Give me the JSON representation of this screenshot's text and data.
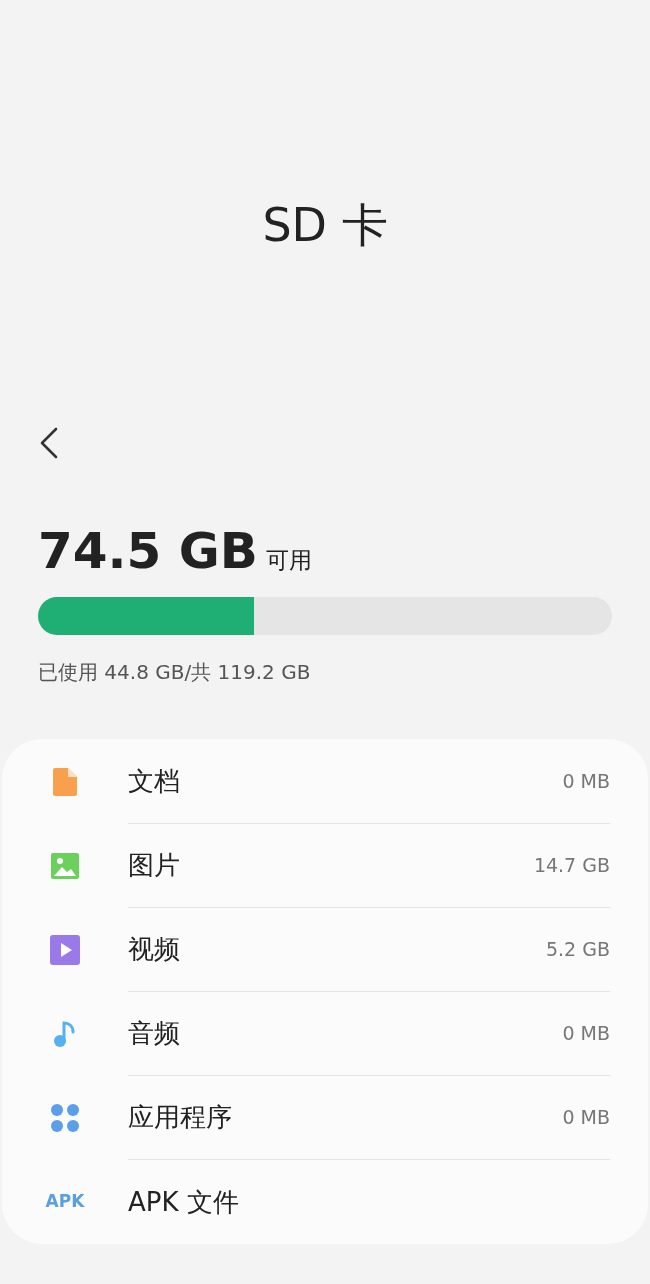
{
  "title": "SD 卡",
  "available": {
    "amount": "74.5 GB",
    "label": "可用"
  },
  "usage": {
    "level": 0.376,
    "text": "已使用 44.8 GB/共 119.2 GB"
  },
  "categories": [
    {
      "kind": "document",
      "label": "文档",
      "size": "0 MB"
    },
    {
      "kind": "image",
      "label": "图片",
      "size": "14.7 GB"
    },
    {
      "kind": "video",
      "label": "视频",
      "size": "5.2 GB"
    },
    {
      "kind": "audio",
      "label": "音频",
      "size": "0 MB"
    },
    {
      "kind": "apps",
      "label": "应用程序",
      "size": "0 MB"
    },
    {
      "kind": "apk",
      "label": "APK 文件",
      "icon_text": "APK"
    }
  ]
}
